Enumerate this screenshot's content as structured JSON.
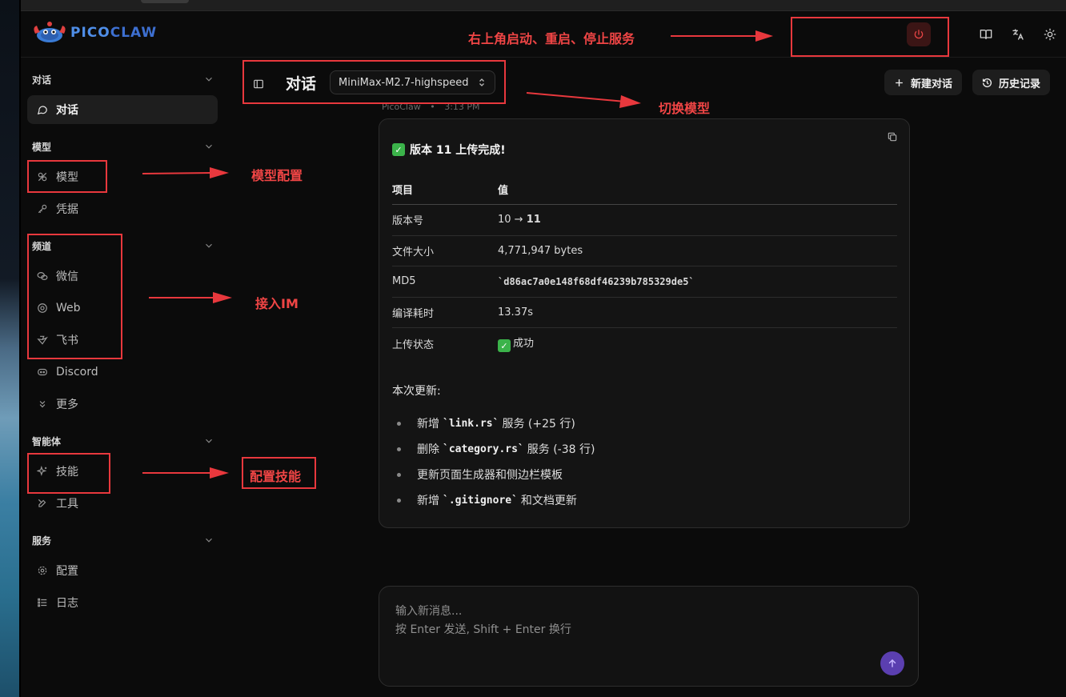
{
  "app": {
    "logo": {
      "pico": "PICO",
      "claw": "CLAW"
    }
  },
  "header": {
    "icons": [
      "book-icon",
      "translate-icon",
      "sun-icon"
    ],
    "power_color": "#e84545"
  },
  "sidebar": {
    "sections": [
      {
        "title": "对话",
        "items": [
          {
            "label": "对话",
            "icon": "message-icon",
            "active": true
          }
        ]
      },
      {
        "title": "模型",
        "items": [
          {
            "label": "模型",
            "icon": "model-icon"
          },
          {
            "label": "凭据",
            "icon": "key-icon"
          }
        ]
      },
      {
        "title": "频道",
        "items": [
          {
            "label": "微信",
            "icon": "wechat-icon"
          },
          {
            "label": "Web",
            "icon": "globe-icon"
          },
          {
            "label": "飞书",
            "icon": "feishu-icon"
          },
          {
            "label": "Discord",
            "icon": "discord-icon"
          },
          {
            "label": "更多",
            "icon": "chevrons-down-icon"
          }
        ]
      },
      {
        "title": "智能体",
        "items": [
          {
            "label": "技能",
            "icon": "sparkle-icon"
          },
          {
            "label": "工具",
            "icon": "tools-icon"
          }
        ]
      },
      {
        "title": "服务",
        "items": [
          {
            "label": "配置",
            "icon": "gear-icon"
          },
          {
            "label": "日志",
            "icon": "list-icon"
          }
        ]
      }
    ]
  },
  "chat": {
    "title": "对话",
    "model": "MiniMax-M2.7-highspeed",
    "new_chat": "新建对话",
    "history": "历史记录",
    "meta_sender": "PicoClaw",
    "meta_sep": "•",
    "meta_time": "3:13 PM"
  },
  "message": {
    "title": "版本 11 上传完成!",
    "table": {
      "headers": [
        "项目",
        "值"
      ],
      "rows": [
        {
          "k": "版本号",
          "v_pre": "10 → ",
          "v_bold": "11"
        },
        {
          "k": "文件大小",
          "v": "4,771,947 bytes"
        },
        {
          "k": "MD5",
          "v_mono": "`d86ac7a0e148f68df46239b785329de5`"
        },
        {
          "k": "编译耗时",
          "v": "13.37s"
        },
        {
          "k": "上传状态",
          "v": "成功"
        }
      ]
    },
    "updates_title": "本次更新:",
    "updates": [
      {
        "pre": "新增",
        "code": "`link.rs`",
        "post": "服务 (+25 行)"
      },
      {
        "pre": "删除",
        "code": "`category.rs`",
        "post": "服务 (-38 行)"
      },
      {
        "pre": "更新页面生成器和侧边栏模板",
        "code": "",
        "post": ""
      },
      {
        "pre": "新增",
        "code": "`.gitignore`",
        "post": "和文档更新"
      }
    ]
  },
  "input": {
    "placeholder": "输入新消息...\n按 Enter 发送, Shift + Enter 换行"
  },
  "annotations": {
    "service": "右上角启动、重启、停止服务",
    "model_switch": "切换模型",
    "model_config": "模型配置",
    "im": "接入IM",
    "skills": "配置技能",
    "color": "#e8383d"
  }
}
